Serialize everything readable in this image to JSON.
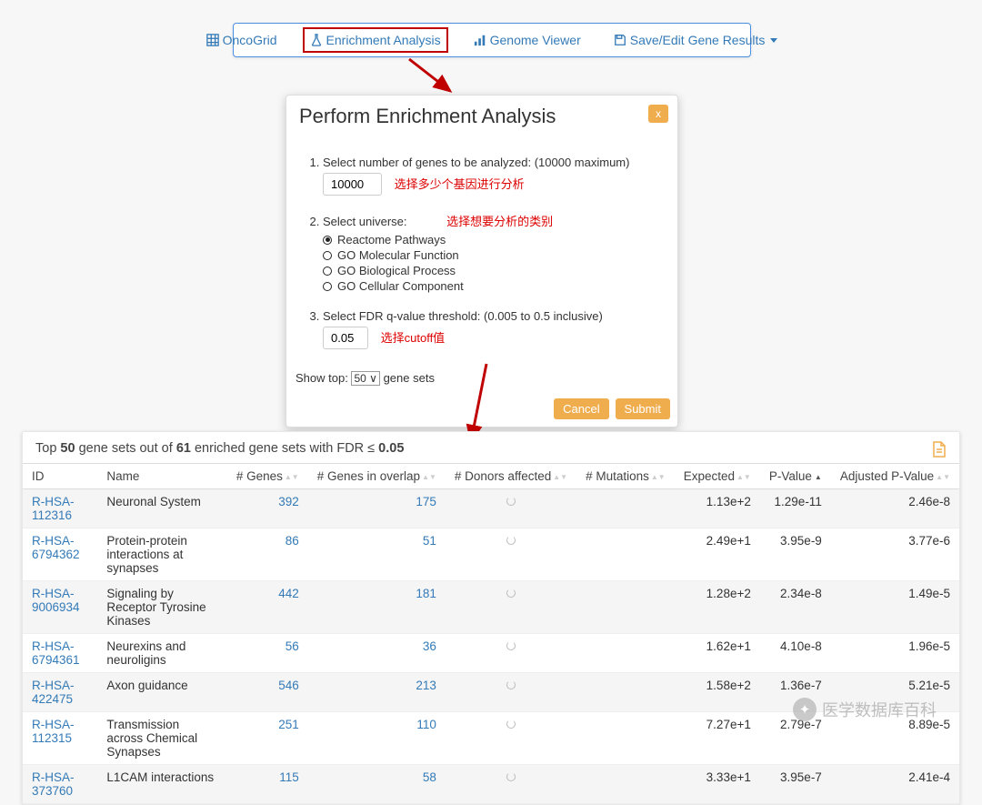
{
  "toolbar": {
    "oncogrid": "OncoGrid",
    "enrichment": "Enrichment Analysis",
    "genome": "Genome Viewer",
    "save": "Save/Edit Gene Results"
  },
  "modal": {
    "title": "Perform Enrichment Analysis",
    "step1": "Select number of genes to be analyzed: (10000 maximum)",
    "genes_value": "10000",
    "annot1": "选择多少个基因进行分析",
    "step2": "Select universe:",
    "annot2": "选择想要分析的类别",
    "universe": {
      "reactome": "Reactome Pathways",
      "go_mf": "GO Molecular Function",
      "go_bp": "GO Biological Process",
      "go_cc": "GO Cellular Component"
    },
    "step3": "Select FDR q-value threshold: (0.005 to 0.5 inclusive)",
    "fdr_value": "0.05",
    "annot3": "选择cutoff值",
    "show_top_pre": "Show top:",
    "show_top_value": "50",
    "show_top_post": "gene sets",
    "cancel": "Cancel",
    "submit": "Submit",
    "close": "x"
  },
  "results": {
    "summary_pre": "Top ",
    "top_n": "50",
    "summary_mid1": " gene sets out of ",
    "total_n": "61",
    "summary_mid2": " enriched gene sets with FDR ≤ ",
    "fdr": "0.05",
    "columns": {
      "id": "ID",
      "name": "Name",
      "genes": "# Genes",
      "overlap": "# Genes in overlap",
      "donors": "# Donors affected",
      "mutations": "# Mutations",
      "expected": "Expected",
      "pvalue": "P-Value",
      "adjpvalue": "Adjusted P-Value"
    },
    "rows": [
      {
        "id": "R-HSA-112316",
        "name": "Neuronal System",
        "genes": "392",
        "overlap": "175",
        "expected": "1.13e+2",
        "pvalue": "1.29e-11",
        "adjp": "2.46e-8"
      },
      {
        "id": "R-HSA-6794362",
        "name": "Protein-protein interactions at synapses",
        "genes": "86",
        "overlap": "51",
        "expected": "2.49e+1",
        "pvalue": "3.95e-9",
        "adjp": "3.77e-6"
      },
      {
        "id": "R-HSA-9006934",
        "name": "Signaling by Receptor Tyrosine Kinases",
        "genes": "442",
        "overlap": "181",
        "expected": "1.28e+2",
        "pvalue": "2.34e-8",
        "adjp": "1.49e-5"
      },
      {
        "id": "R-HSA-6794361",
        "name": "Neurexins and neuroligins",
        "genes": "56",
        "overlap": "36",
        "expected": "1.62e+1",
        "pvalue": "4.10e-8",
        "adjp": "1.96e-5"
      },
      {
        "id": "R-HSA-422475",
        "name": "Axon guidance",
        "genes": "546",
        "overlap": "213",
        "expected": "1.58e+2",
        "pvalue": "1.36e-7",
        "adjp": "5.21e-5"
      },
      {
        "id": "R-HSA-112315",
        "name": "Transmission across Chemical Synapses",
        "genes": "251",
        "overlap": "110",
        "expected": "7.27e+1",
        "pvalue": "2.79e-7",
        "adjp": "8.89e-5"
      },
      {
        "id": "R-HSA-373760",
        "name": "L1CAM interactions",
        "genes": "115",
        "overlap": "58",
        "expected": "3.33e+1",
        "pvalue": "3.95e-7",
        "adjp": "2.41e-4"
      }
    ]
  },
  "watermark": "医学数据库百科"
}
